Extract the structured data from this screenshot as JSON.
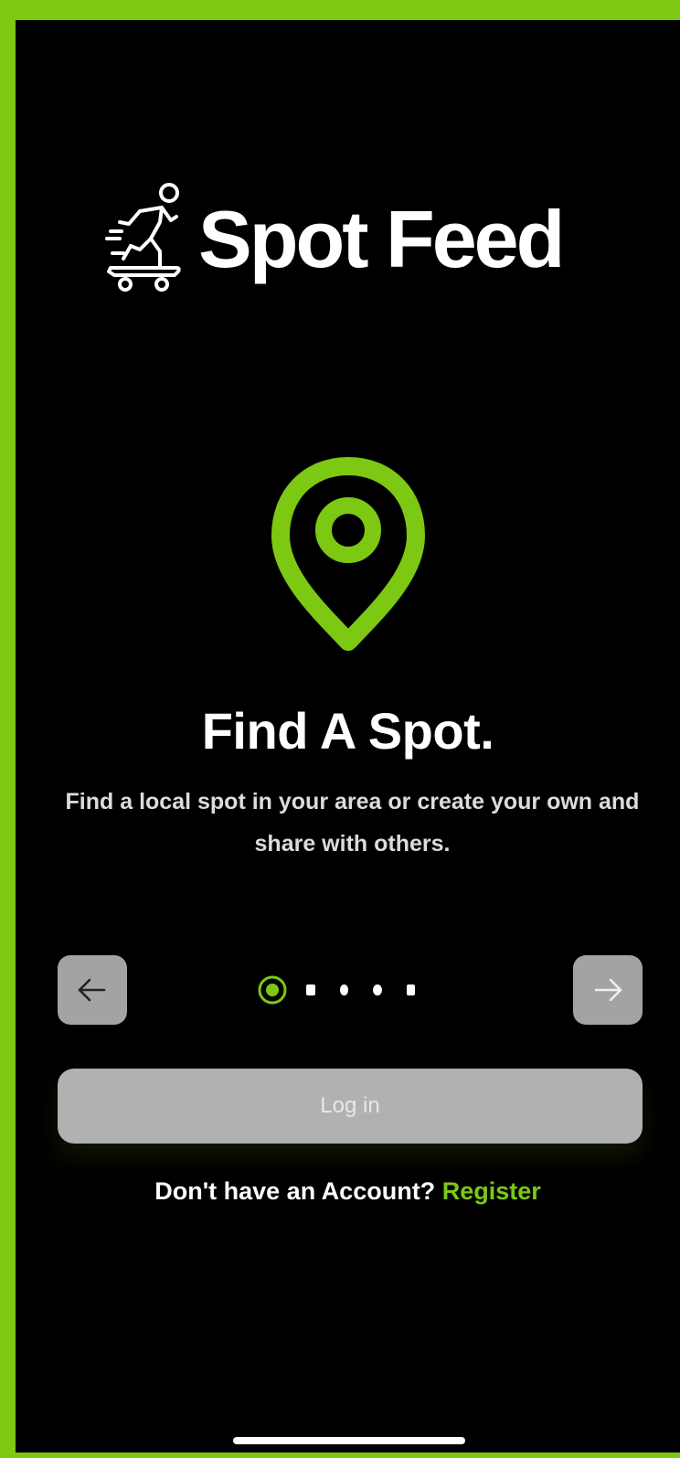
{
  "app": {
    "logo_text": "Spot Feed",
    "logo_icon": "skateboarder-icon"
  },
  "onboarding": {
    "title": "Find A Spot.",
    "subtitle": "Find a local spot in your area or create your own and share with others.",
    "illustration_icon": "map-pin-icon",
    "page_count": 5,
    "current_page": 1
  },
  "nav": {
    "prev_icon": "arrow-left-icon",
    "next_icon": "arrow-right-icon",
    "prev_glyph": "←",
    "next_glyph": "→"
  },
  "auth": {
    "login_label": "Log in",
    "register_prompt": "Don't have an Account?",
    "register_label": "Register"
  },
  "colors": {
    "accent": "#7cc813",
    "background": "#000000",
    "button_gray": "#a3a3a3",
    "login_gray": "#b1b1b1"
  }
}
